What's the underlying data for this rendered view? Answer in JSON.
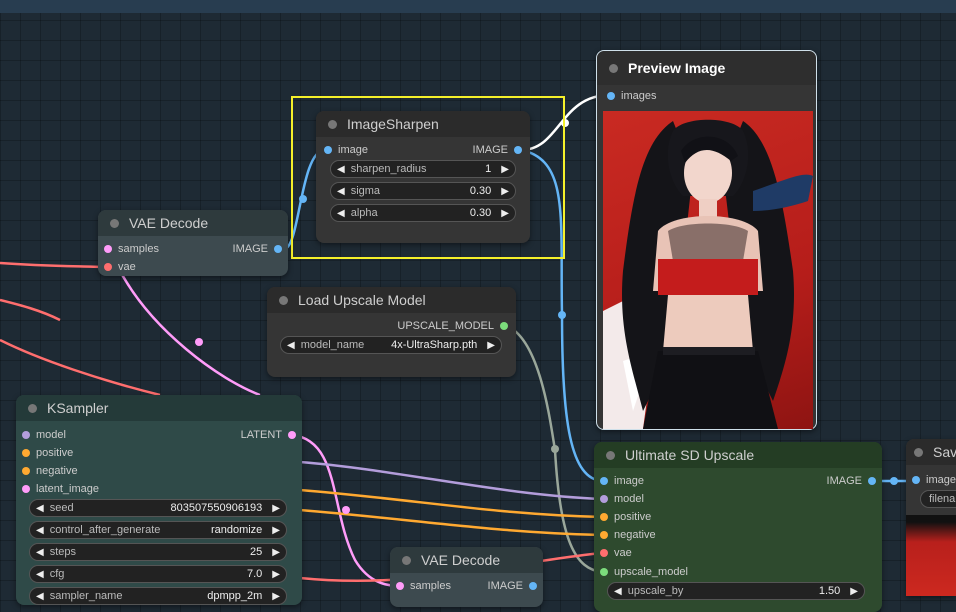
{
  "nodes": {
    "image_sharpen": {
      "title": "ImageSharpen",
      "input": "image",
      "output": "IMAGE",
      "widgets": [
        {
          "label": "sharpen_radius",
          "value": "1"
        },
        {
          "label": "sigma",
          "value": "0.30"
        },
        {
          "label": "alpha",
          "value": "0.30"
        }
      ]
    },
    "preview_image": {
      "title": "Preview Image",
      "input": "images"
    },
    "vae_decode_1": {
      "title": "VAE Decode",
      "inputs": [
        "samples",
        "vae"
      ],
      "output": "IMAGE"
    },
    "load_upscale_model": {
      "title": "Load Upscale Model",
      "output": "UPSCALE_MODEL",
      "widget": {
        "label": "model_name",
        "value": "4x-UltraSharp.pth"
      }
    },
    "ksampler": {
      "title": "KSampler",
      "inputs": [
        "model",
        "positive",
        "negative",
        "latent_image"
      ],
      "output": "LATENT",
      "widgets": [
        {
          "label": "seed",
          "value": "803507550906193"
        },
        {
          "label": "control_after_generate",
          "value": "randomize"
        },
        {
          "label": "steps",
          "value": "25"
        },
        {
          "label": "cfg",
          "value": "7.0"
        },
        {
          "label": "sampler_name",
          "value": "dpmpp_2m"
        }
      ]
    },
    "vae_decode_2": {
      "title": "VAE Decode",
      "input": "samples",
      "output": "IMAGE"
    },
    "ultimate_sd_upscale": {
      "title": "Ultimate SD Upscale",
      "inputs": [
        "image",
        "model",
        "positive",
        "negative",
        "vae",
        "upscale_model"
      ],
      "output": "IMAGE",
      "widget": {
        "label": "upscale_by",
        "value": "1.50"
      }
    },
    "save_image": {
      "title": "Sav",
      "input": "images",
      "widget_label": "filena"
    }
  },
  "colors": {
    "latent": "#ff9cf9",
    "image": "#64b5f6",
    "vae": "#ff6e6e",
    "model": "#b39ddb",
    "conditioning": "#ffa931",
    "upscale_model": "#7cdc7c",
    "selection": "#f5f02a",
    "canvas": "#1e2a34"
  },
  "icons": {
    "decrement": "arrow-left-icon",
    "increment": "arrow-right-icon",
    "node_collapse": "circle-dot-icon"
  }
}
